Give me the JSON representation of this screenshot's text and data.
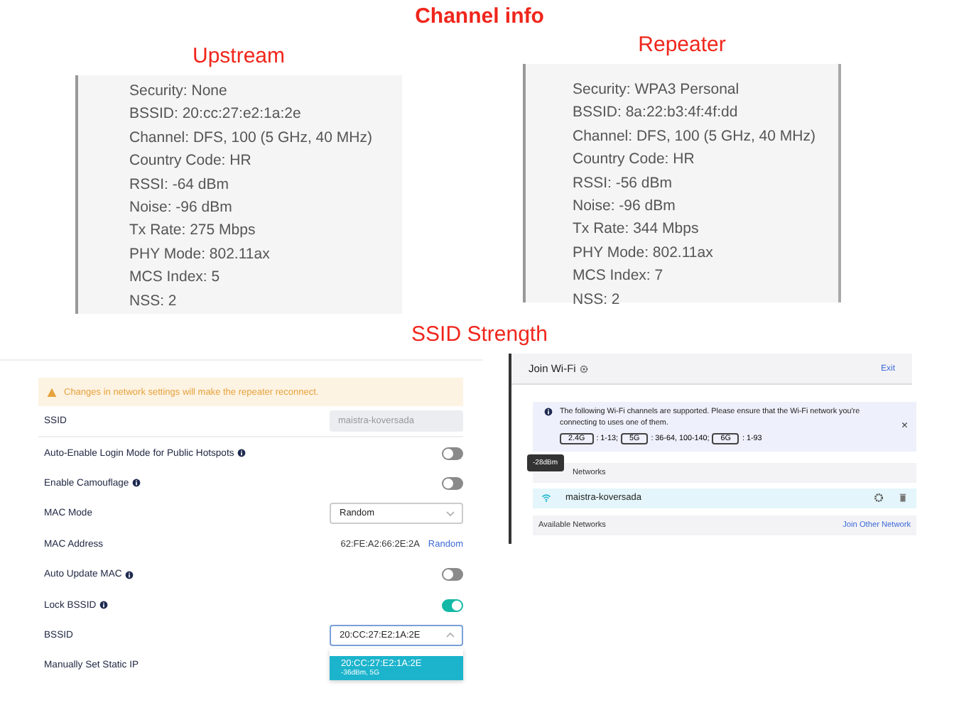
{
  "title": "Channel info",
  "panels": [
    {
      "heading": "Upstream",
      "lines": [
        "Security: None",
        "BSSID: 20:cc:27:e2:1a:2e",
        "Channel: DFS, 100 (5 GHz, 40 MHz)",
        "Country Code: HR",
        "RSSI: -64 dBm",
        "Noise: -96 dBm",
        "Tx Rate: 275 Mbps",
        "PHY Mode: 802.11ax",
        "MCS Index: 5",
        "NSS: 2"
      ]
    },
    {
      "heading": "Repeater",
      "lines": [
        "Security: WPA3 Personal",
        "BSSID: 8a:22:b3:4f:4f:dd",
        "Channel: DFS, 100 (5 GHz, 40 MHz)",
        "Country Code: HR",
        "RSSI: -56 dBm",
        "Noise: -96 dBm",
        "Tx Rate: 344 Mbps",
        "PHY Mode: 802.11ax",
        "MCS Index: 7",
        "NSS: 2"
      ]
    }
  ],
  "subtitle": "SSID Strength",
  "settings": {
    "warning": "Changes in network settings will make the repeater reconnect.",
    "rows": [
      {
        "kind": "field",
        "label": "SSID",
        "info": false,
        "value": "maistra-koversada"
      },
      {
        "kind": "toggle",
        "label": "Auto-Enable Login Mode for Public Hotspots",
        "info": true,
        "on": false
      },
      {
        "kind": "toggle",
        "label": "Enable Camouflage",
        "info": true,
        "on": false
      },
      {
        "kind": "select",
        "label": "MAC Mode",
        "info": false,
        "value": "Random",
        "expanded": false
      },
      {
        "kind": "mac",
        "label": "MAC Address",
        "info": false,
        "value": "62:FE:A2:66:2E:2A",
        "link": "Random"
      },
      {
        "kind": "toggle",
        "label": "Auto Update MAC",
        "info": true,
        "on": false
      },
      {
        "kind": "toggle",
        "label": "Lock BSSID",
        "info": true,
        "on": true
      },
      {
        "kind": "select",
        "label": "BSSID",
        "info": false,
        "value": "20:CC:27:E2:1A:2E",
        "expanded": true,
        "options": [
          {
            "label": "20:CC:27:E2:1A:2E",
            "detail": "-36dBm, 5G",
            "selected": true
          }
        ]
      },
      {
        "kind": "label",
        "label": "Manually Set Static IP",
        "info": false
      }
    ]
  },
  "join_wifi": {
    "title": "Join Wi-Fi",
    "exit": "Exit",
    "notice": "The following Wi-Fi channels are supported. Please ensure that the Wi-Fi network you're connecting to uses one of them.",
    "bands": [
      {
        "band": "2.4G",
        "channels": ": 1-13;"
      },
      {
        "band": "5G",
        "channels": ": 36-64, 100-140;"
      },
      {
        "band": "6G",
        "channels": ": 1-93"
      }
    ],
    "close": "×",
    "saved_header": "Networks",
    "tooltip": "-28dBm",
    "saved": [
      {
        "name": "maistra-koversada"
      }
    ],
    "available_header": "Available Networks",
    "join_other": "Join Other Network"
  }
}
